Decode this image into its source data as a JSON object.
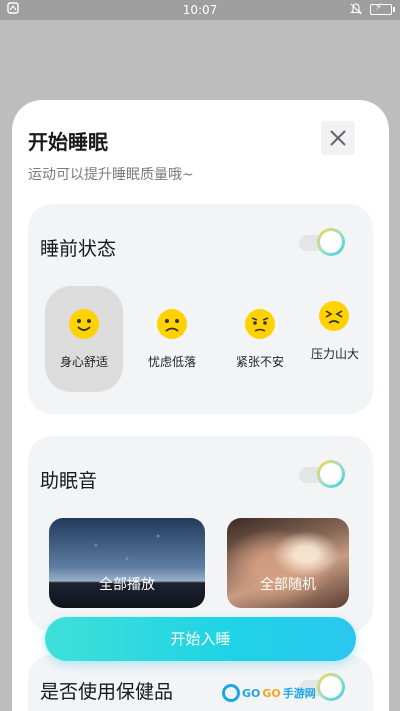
{
  "status_bar": {
    "time": "10:07",
    "icons": [
      "app-icon",
      "bell-off-icon",
      "battery-charging-icon"
    ]
  },
  "sheet": {
    "title": "开始睡眠",
    "subtitle": "运动可以提升睡眠质量哦~",
    "close_icon": "close-icon"
  },
  "pre_sleep": {
    "title": "睡前状态",
    "toggle_on": true,
    "moods": [
      {
        "label": "身心舒适",
        "icon": "smile-icon",
        "selected": true
      },
      {
        "label": "忧虑低落",
        "icon": "frown-icon",
        "selected": false
      },
      {
        "label": "紧张不安",
        "icon": "worried-icon",
        "selected": false
      },
      {
        "label": "压力山大",
        "icon": "stressed-icon",
        "selected": false
      }
    ]
  },
  "sleep_sound": {
    "title": "助眠音",
    "toggle_on": true,
    "cards": [
      {
        "label": "全部播放"
      },
      {
        "label": "全部随机"
      }
    ]
  },
  "start_button": {
    "label": "开始入睡"
  },
  "third_section": {
    "title": "是否使用保健品",
    "toggle_on": true
  },
  "colors": {
    "accent": "#1fd3e6",
    "card_bg": "#f3f4f6",
    "selected_bg": "#dcdcdc",
    "emoji": "#ffd200"
  },
  "watermark": {
    "go1": "GO",
    "go2": "GO",
    "cn": "手游网"
  }
}
